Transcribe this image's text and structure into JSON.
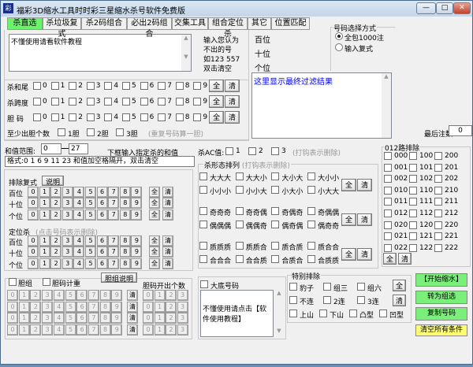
{
  "window": {
    "title": "福彩3D缩水工具时时彩三星缩水杀号软件免费版",
    "app_icon": "彩",
    "minimize": "—",
    "maximize": "□",
    "close": "✕"
  },
  "tabs": [
    "杀直选",
    "杀垃圾复式",
    "杀2码组合",
    "必出2码组合",
    "交集工具",
    "组合定位杀",
    "其它",
    "位置匹配"
  ],
  "kill_input": {
    "value": "不懂使用请看软件教程",
    "hint": [
      "输入您认为",
      "不出的号",
      "如123   557",
      "双击清空"
    ]
  },
  "positions": [
    "百位",
    "十位",
    "个位"
  ],
  "select_mode": {
    "title": "号码选择方式",
    "options": [
      "全包1000注",
      "输入复式"
    ],
    "selected": 0
  },
  "result": {
    "value": "这里显示最终过滤结果"
  },
  "digit_rows": [
    {
      "label": "杀和尾"
    },
    {
      "label": "杀跨度"
    },
    {
      "label": "胆  码"
    }
  ],
  "digits": [
    "0",
    "1",
    "2",
    "3",
    "4",
    "5",
    "6",
    "7",
    "8",
    "9"
  ],
  "all_label": "全",
  "clear_label": "清",
  "dan_count": {
    "label": "至少出胆个数",
    "options": [
      "1胆",
      "2胆",
      "3胆"
    ],
    "note": "(重复号码算一胆)"
  },
  "last_count": {
    "label": "最后注数",
    "value": "0"
  },
  "sum_range": {
    "label": "和值范围:",
    "from": "0",
    "to": "27",
    "hint": "下框输入指定杀的和值",
    "format": "格式:0 1 6 9 11 23 和值加空格隔开，双击清空"
  },
  "ac": {
    "label": "杀AC值:",
    "options": [
      "1",
      "2",
      "3"
    ],
    "note": "(打钩表示删除)"
  },
  "exclude": {
    "title": "排除复式",
    "help": "说明",
    "pos_kill_title": "定位杀",
    "pos_kill_note": "(点击号码表示删除)"
  },
  "shape": {
    "title": "杀形态排列",
    "note": "(打钩表示删除)",
    "groups": [
      [
        "大大大",
        "大大小",
        "大小大",
        "大小小",
        "小小小",
        "小小大",
        "小大小",
        "小大大"
      ],
      [
        "奇奇奇",
        "奇奇偶",
        "奇偶奇",
        "奇偶偶",
        "偶偶偶",
        "偶偶奇",
        "偶奇偶",
        "偶奇奇"
      ],
      [
        "质质质",
        "质质合",
        "质合质",
        "质合合",
        "合合合",
        "合合质",
        "合质合",
        "合质质"
      ]
    ]
  },
  "road012": {
    "title": "012路排除",
    "items": [
      "000",
      "100",
      "200",
      "001",
      "101",
      "201",
      "002",
      "102",
      "202",
      "010",
      "110",
      "210",
      "011",
      "111",
      "211",
      "012",
      "112",
      "212",
      "020",
      "120",
      "220",
      "021",
      "121",
      "221",
      "022",
      "122",
      "222"
    ]
  },
  "dan_group": {
    "check1": "胆组",
    "check2": "胆码计重",
    "help": "胆组说明",
    "count_title": "胆码开出个数",
    "counts": [
      "0",
      "1",
      "2",
      "3"
    ]
  },
  "base": {
    "label": "大底号码",
    "value": "不懂使用请点击【软件使用教程】"
  },
  "special": {
    "title": "特别排除",
    "items": [
      "豹子",
      "组三",
      "组六",
      "不连",
      "2连",
      "3连",
      "上山",
      "下山",
      "凸型",
      "凹型"
    ]
  },
  "actions": {
    "start": "【开始缩水】",
    "to_group": "转为组选",
    "copy": "复制号码",
    "clear_all": "清空所有条件"
  },
  "colors": {
    "active_tab": "#6ef26e",
    "action_green": "#7af07a",
    "clear_yellow": "#ffff70",
    "result_text": "#0000ff"
  }
}
